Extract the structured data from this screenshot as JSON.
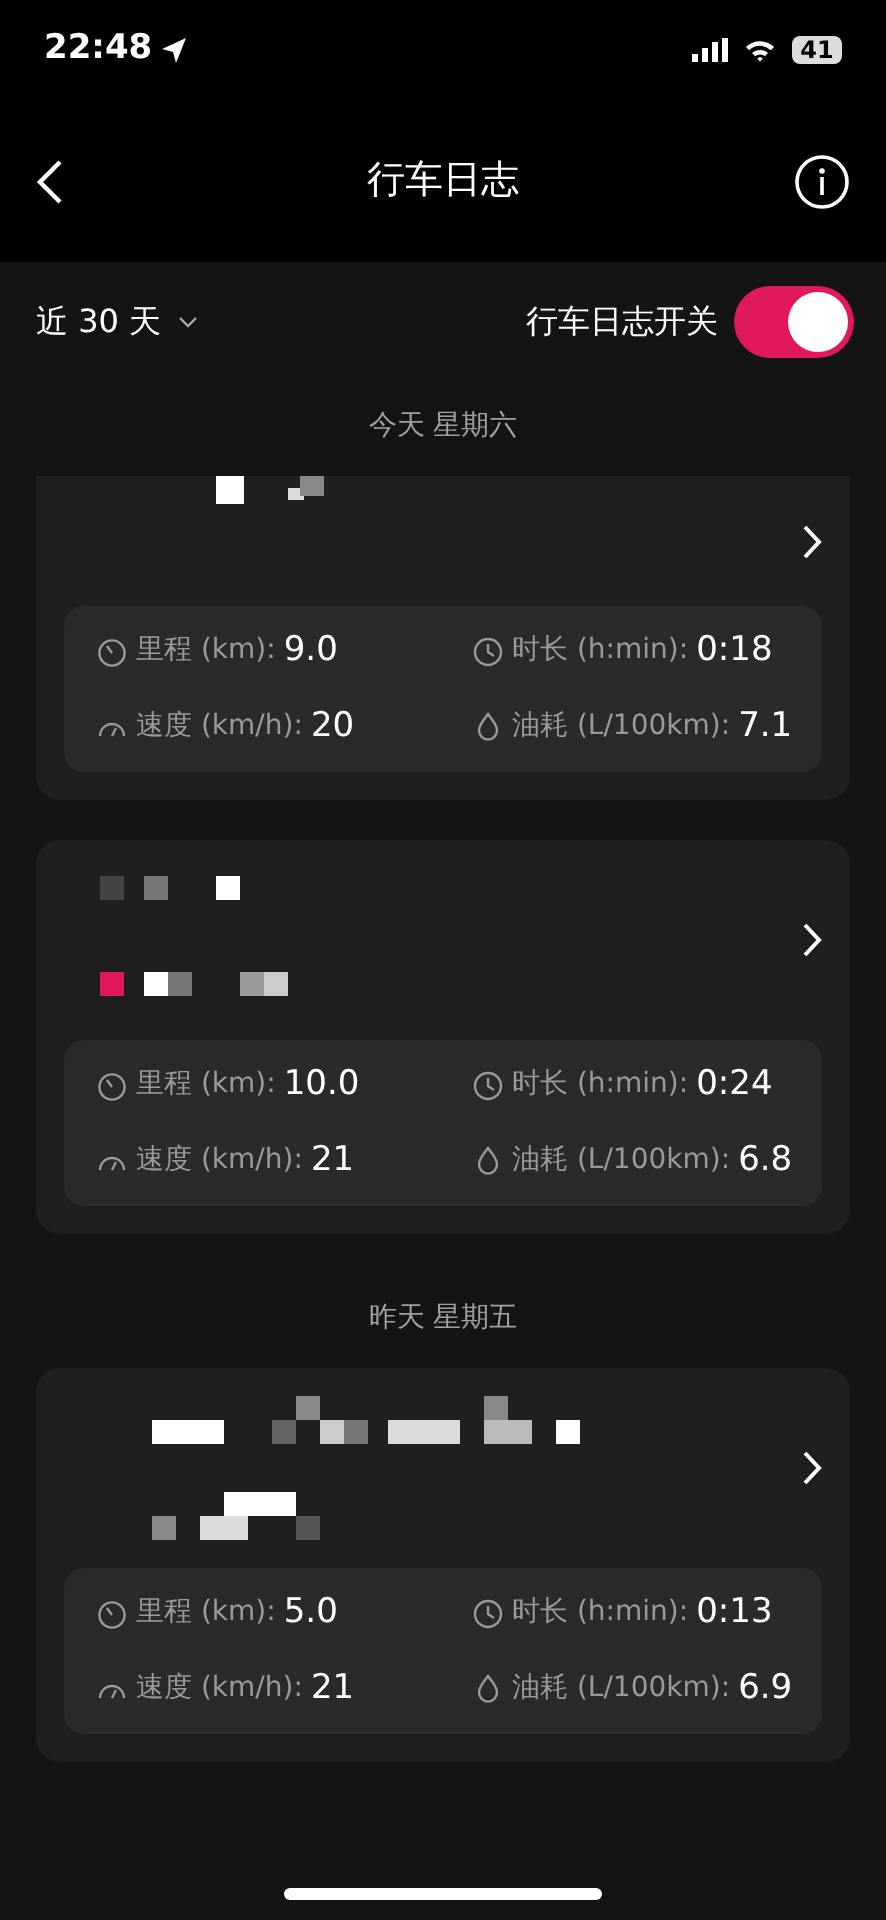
{
  "status_bar": {
    "time": "22:48",
    "battery": "41"
  },
  "header": {
    "title": "行车日志"
  },
  "filter": {
    "range": "近 30 天",
    "toggle_label": "行车日志开关",
    "toggle_on": true
  },
  "groups": [
    {
      "date": "今天 星期六",
      "trips": [
        {
          "clipped": true,
          "stats": [
            {
              "kind": "distance",
              "label": "里程 (km):",
              "value": "9.0"
            },
            {
              "kind": "duration",
              "label": "时长 (h:min):",
              "value": "0:18"
            },
            {
              "kind": "speed",
              "label": "速度 (km/h):",
              "value": "20"
            },
            {
              "kind": "fuel",
              "label": "油耗 (L/100km):",
              "value": "7.1"
            }
          ]
        },
        {
          "clipped": false,
          "stats": [
            {
              "kind": "distance",
              "label": "里程 (km):",
              "value": "10.0"
            },
            {
              "kind": "duration",
              "label": "时长 (h:min):",
              "value": "0:24"
            },
            {
              "kind": "speed",
              "label": "速度 (km/h):",
              "value": "21"
            },
            {
              "kind": "fuel",
              "label": "油耗 (L/100km):",
              "value": "6.8"
            }
          ]
        }
      ]
    },
    {
      "date": "昨天 星期五",
      "trips": [
        {
          "clipped": false,
          "stats": [
            {
              "kind": "distance",
              "label": "里程 (km):",
              "value": "5.0"
            },
            {
              "kind": "duration",
              "label": "时长 (h:min):",
              "value": "0:13"
            },
            {
              "kind": "speed",
              "label": "速度 (km/h):",
              "value": "21"
            },
            {
              "kind": "fuel",
              "label": "油耗 (L/100km):",
              "value": "6.9"
            }
          ]
        }
      ]
    }
  ]
}
